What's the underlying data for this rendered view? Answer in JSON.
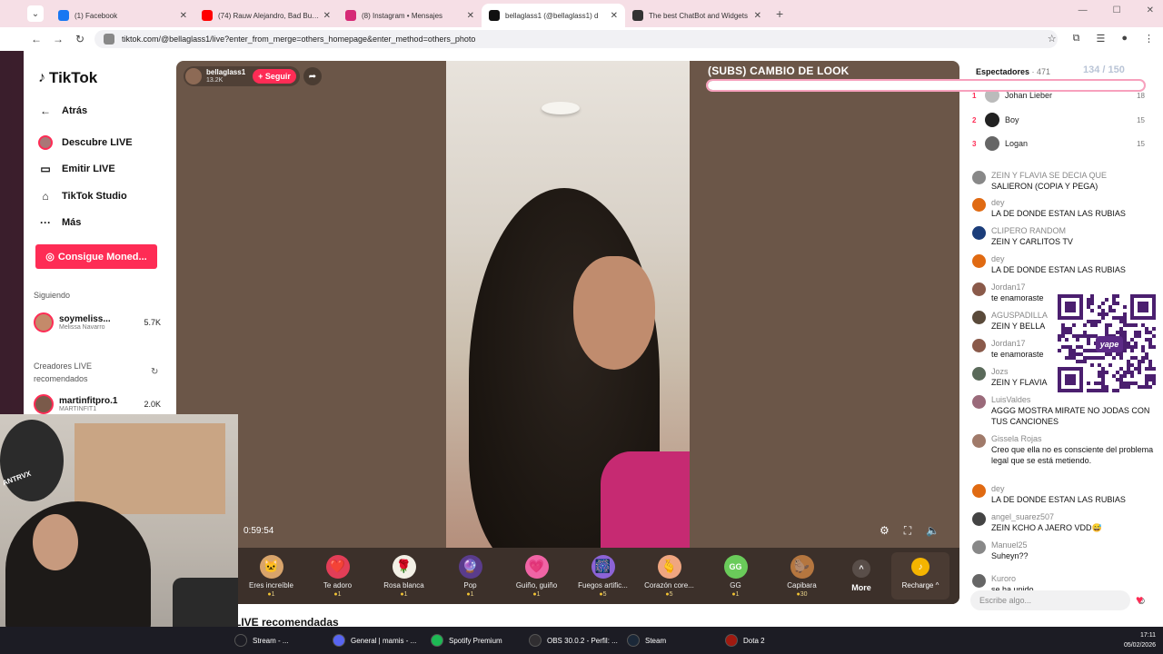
{
  "tabs": [
    {
      "title": "(1) Facebook",
      "icon": "facebook-icon",
      "color": "#1877f2",
      "active": false
    },
    {
      "title": "(74) Rauw Alejandro, Bad Bunn",
      "icon": "youtube-icon",
      "color": "#ff0000",
      "active": false
    },
    {
      "title": "(8) Instagram • Mensajes",
      "icon": "instagram-icon",
      "color": "#d62976",
      "active": false
    },
    {
      "title": "bellaglass1 (@bellaglass1) d",
      "icon": "tiktok-icon",
      "color": "#111111",
      "active": true
    },
    {
      "title": "The best ChatBot and Widgets",
      "icon": "chatbot-icon",
      "color": "#333333",
      "active": false
    }
  ],
  "url": "tiktok.com/@bellaglass1/live?enter_from_merge=others_homepage&enter_method=others_photo",
  "sidebar": {
    "logo": "TikTok",
    "back": "Atrás",
    "items": [
      {
        "label": "Descubre LIVE",
        "icon": "live-avatar-icon"
      },
      {
        "label": "Emitir LIVE",
        "icon": "camera-icon"
      },
      {
        "label": "TikTok Studio",
        "icon": "home-icon"
      },
      {
        "label": "Más",
        "icon": "more-icon"
      }
    ],
    "coin_button": "Consigue Moned...",
    "following_title": "Siguiendo",
    "following": [
      {
        "name": "soymeliss...",
        "sub": "Melissa Navarro",
        "count": "5.7K"
      }
    ],
    "creators_title": "Creadores LIVE recomendados",
    "creators": [
      {
        "name": "martinfitpro.1",
        "sub": "MARTINFIT1",
        "count": "2.0K"
      }
    ]
  },
  "stream": {
    "host_name": "bellaglass1",
    "host_likes": "13.2K",
    "follow_label": "+ Seguir",
    "goal_title": "(SUBS) CAMBIO DE LOOK",
    "goal_count": "134 / 150",
    "goal_progress": 0.89,
    "timer": "0:59:54",
    "recommendations": "LIVE recomendadas"
  },
  "gifts": [
    {
      "name": "Eres increíble",
      "cost": "1",
      "emoji": "🐱"
    },
    {
      "name": "Te adoro",
      "cost": "1",
      "emoji": "❤️"
    },
    {
      "name": "Rosa blanca",
      "cost": "1",
      "emoji": "🌹"
    },
    {
      "name": "Pop",
      "cost": "1",
      "emoji": "🔮"
    },
    {
      "name": "Guiño, guiño",
      "cost": "1",
      "emoji": "💗"
    },
    {
      "name": "Fuegos artific...",
      "cost": "5",
      "emoji": "🎆"
    },
    {
      "name": "Corazón core...",
      "cost": "5",
      "emoji": "🫰"
    },
    {
      "name": "GG",
      "cost": "1",
      "emoji": "GG"
    },
    {
      "name": "Capibara",
      "cost": "30",
      "emoji": "🦫"
    }
  ],
  "more_label": "More",
  "recharge_label": "Recharge ^",
  "chat": {
    "viewers_label": "Espectadores",
    "viewers_count": "· 471",
    "ranking": [
      {
        "rank": "1",
        "name": "Johan Lieber",
        "score": "18"
      },
      {
        "rank": "2",
        "name": "Boy",
        "score": "15"
      },
      {
        "rank": "3",
        "name": "Logan",
        "score": "15"
      }
    ],
    "messages": [
      {
        "user": "ZEIN Y FLAVIA SE DECIA QUE",
        "text": "SALIERON (COPIA Y PEGA)",
        "color": "#888888"
      },
      {
        "user": "dey",
        "text": "LA DE DONDE ESTAN LAS RUBIAS",
        "color": "#e06a12"
      },
      {
        "user": "CLIPERO RANDOM",
        "text": "ZEIN Y CARLITOS TV",
        "color": "#1b3d7a"
      },
      {
        "user": "dey",
        "text": "LA DE DONDE ESTAN LAS RUBIAS",
        "color": "#e06a12"
      },
      {
        "user": "Jordan17",
        "text": "te enamoraste",
        "color": "#8a5a4a"
      },
      {
        "user": "AGUSPADILLA",
        "text": "ZEIN Y BELLA",
        "color": "#5a4a3a"
      },
      {
        "user": "Jordan17",
        "text": "te enamoraste",
        "color": "#8a5a4a"
      },
      {
        "user": "Jozs",
        "text": "ZEIN Y FLAVIA",
        "color": "#5a6a5a"
      },
      {
        "user": "LuisValdes",
        "text": "AGGG MOSTRA MIRATE NO JODAS CON TUS CANCIONES",
        "color": "#9a6a7a"
      },
      {
        "user": "Gissela Rojas",
        "text": "Creo que ella no es consciente del problema legal que se está metiendo.",
        "color": "#a07a6a"
      },
      {
        "user": "dey",
        "text": "LA DE DONDE ESTAN LAS RUBIAS",
        "color": "#e06a12"
      },
      {
        "user": "angel_suarez507",
        "text": "ZEIN KCHO A JAERO VDD😅",
        "color": "#444444"
      },
      {
        "user": "Manuel25",
        "text": "Suheyn??",
        "color": "#888888"
      },
      {
        "user": "Kuroro",
        "text": "se ha unido",
        "color": "#666666"
      }
    ],
    "input_placeholder": "Escribe algo..."
  },
  "taskbar": [
    {
      "label": "Stream - ...",
      "color": "#1c1c24"
    },
    {
      "label": "General | mamis - ...",
      "color": "#5865f2"
    },
    {
      "label": "Spotify Premium",
      "color": "#1db954"
    },
    {
      "label": "OBS 30.0.2 - Perfil: ...",
      "color": "#302e31"
    },
    {
      "label": "Steam",
      "color": "#1b2838"
    },
    {
      "label": "Dota 2",
      "color": "#a01a10"
    }
  ],
  "clock": {
    "time": "17:11",
    "date": "05/02/2026"
  },
  "webcam_caption": "ANTRVX",
  "qr_brand": "yape"
}
